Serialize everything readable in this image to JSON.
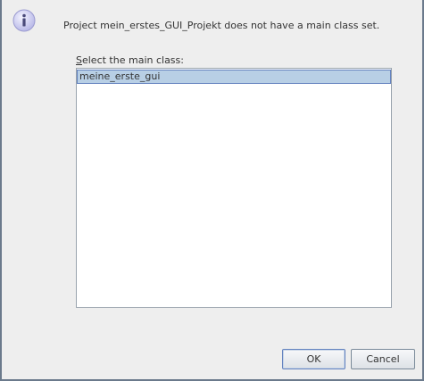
{
  "dialog": {
    "icon": "info-icon",
    "message": "Project mein_erstes_GUI_Projekt does not have a main class set.",
    "select_label_mnemonic": "S",
    "select_label_rest": "elect the main class:",
    "list_items": [
      "meine_erste_gui"
    ],
    "selected_index": 0,
    "ok_label": "OK",
    "cancel_label": "Cancel"
  },
  "colors": {
    "background": "#eeeeee",
    "selection": "#b8cfe5",
    "selection_border": "#6382bf",
    "icon_fill": "#c8c8f0"
  }
}
